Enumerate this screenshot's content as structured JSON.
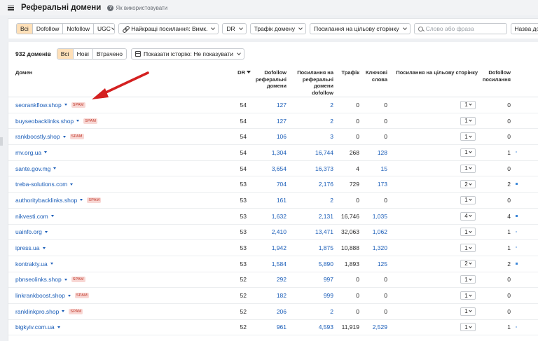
{
  "header": {
    "title": "Реферальні домени",
    "help": "Як використовувати"
  },
  "filters": {
    "segment": [
      "Всі",
      "Dofollow",
      "Nofollow",
      "UGC"
    ],
    "best_links": "Найкращі посилання: Вимк.",
    "dr": "DR",
    "traffic": "Трафік домену",
    "target": "Посилання на цільову сторінку",
    "search_placeholder": "Слово або фраза",
    "domain_name": "Назва домену"
  },
  "summary": {
    "count": "932 доменів",
    "tabs": [
      "Всі",
      "Нові",
      "Втрачено"
    ],
    "history": "Показати історію: Не показувати"
  },
  "columns": {
    "domain": "Домен",
    "dr": "DR",
    "dofollow": "Dofollow реферальні домени",
    "ref_links": "Посилання на реферальні домени dofollow",
    "traffic": "Трафік",
    "keywords": "Ключові слова",
    "target": "Посилання на цільову сторінку",
    "dofollow_links": "Dofollow посилання"
  },
  "spam_label": "SPAM",
  "rows": [
    {
      "domain": "seorankflow.shop",
      "spam": true,
      "dr": "54",
      "dofollow": "127",
      "ref": "2",
      "traffic": "0",
      "kw": "0",
      "target": "1",
      "df": "0",
      "bar": ""
    },
    {
      "domain": "buyseobacklinks.shop",
      "spam": true,
      "dr": "54",
      "dofollow": "127",
      "ref": "2",
      "traffic": "0",
      "kw": "0",
      "target": "1",
      "df": "0",
      "bar": ""
    },
    {
      "domain": "rankboostly.shop",
      "spam": true,
      "dr": "54",
      "dofollow": "106",
      "ref": "3",
      "traffic": "0",
      "kw": "0",
      "target": "1",
      "df": "0",
      "bar": ""
    },
    {
      "domain": "mv.org.ua",
      "spam": false,
      "dr": "54",
      "dofollow": "1,304",
      "ref": "16,744",
      "traffic": "268",
      "kw": "128",
      "target": "1",
      "df": "1",
      "bar": "lite"
    },
    {
      "domain": "sante.gov.mg",
      "spam": false,
      "dr": "54",
      "dofollow": "3,654",
      "ref": "16,373",
      "traffic": "4",
      "kw": "15",
      "target": "1",
      "df": "0",
      "bar": ""
    },
    {
      "domain": "treba-solutions.com",
      "spam": false,
      "dr": "53",
      "dofollow": "704",
      "ref": "2,176",
      "traffic": "729",
      "kw": "173",
      "target": "2",
      "df": "2",
      "bar": "dark"
    },
    {
      "domain": "authoritybacklinks.shop",
      "spam": true,
      "dr": "53",
      "dofollow": "161",
      "ref": "2",
      "traffic": "0",
      "kw": "0",
      "target": "1",
      "df": "0",
      "bar": ""
    },
    {
      "domain": "nikvesti.com",
      "spam": false,
      "dr": "53",
      "dofollow": "1,632",
      "ref": "2,131",
      "traffic": "16,746",
      "kw": "1,035",
      "target": "4",
      "df": "4",
      "bar": "dark"
    },
    {
      "domain": "uainfo.org",
      "spam": false,
      "dr": "53",
      "dofollow": "2,410",
      "ref": "13,471",
      "traffic": "32,063",
      "kw": "1,062",
      "target": "1",
      "df": "1",
      "bar": "lite"
    },
    {
      "domain": "ipress.ua",
      "spam": false,
      "dr": "53",
      "dofollow": "1,942",
      "ref": "1,875",
      "traffic": "10,888",
      "kw": "1,320",
      "target": "1",
      "df": "1",
      "bar": "lite"
    },
    {
      "domain": "kontrakty.ua",
      "spam": false,
      "dr": "53",
      "dofollow": "1,584",
      "ref": "5,890",
      "traffic": "1,893",
      "kw": "125",
      "target": "2",
      "df": "2",
      "bar": "dark"
    },
    {
      "domain": "pbnseolinks.shop",
      "spam": true,
      "dr": "52",
      "dofollow": "292",
      "ref": "997",
      "traffic": "0",
      "kw": "0",
      "target": "1",
      "df": "0",
      "bar": ""
    },
    {
      "domain": "linkrankboost.shop",
      "spam": true,
      "dr": "52",
      "dofollow": "182",
      "ref": "999",
      "traffic": "0",
      "kw": "0",
      "target": "1",
      "df": "0",
      "bar": ""
    },
    {
      "domain": "ranklinkpro.shop",
      "spam": true,
      "dr": "52",
      "dofollow": "206",
      "ref": "2",
      "traffic": "0",
      "kw": "0",
      "target": "1",
      "df": "0",
      "bar": ""
    },
    {
      "domain": "bigkyiv.com.ua",
      "spam": false,
      "dr": "52",
      "dofollow": "961",
      "ref": "4,593",
      "traffic": "11,919",
      "kw": "2,529",
      "target": "1",
      "df": "1",
      "bar": "lite"
    }
  ]
}
